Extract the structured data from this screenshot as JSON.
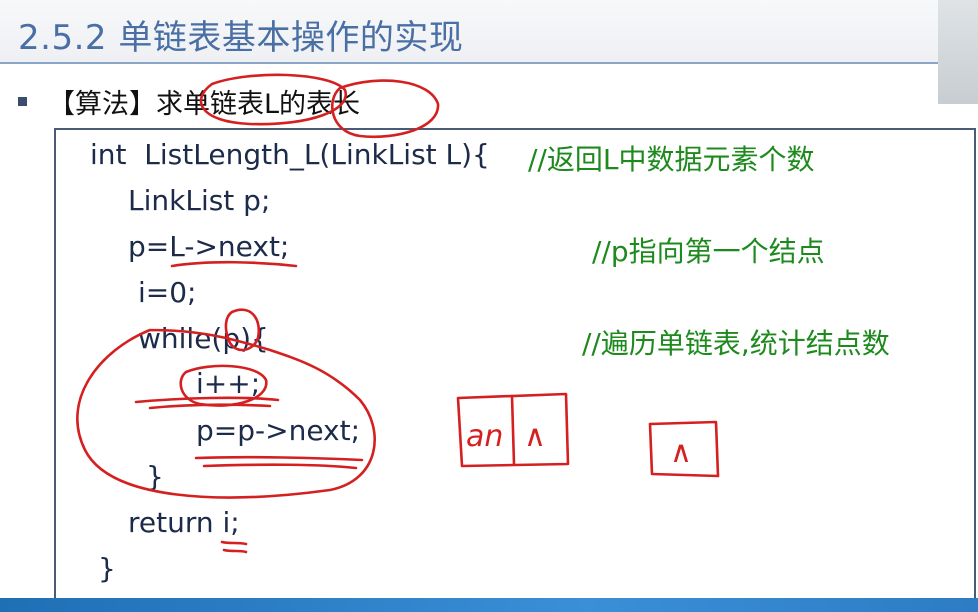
{
  "slide": {
    "title": "2.5.2 单链表基本操作的实现",
    "heading": "【算法】求单链表L的表长"
  },
  "code": {
    "line1": "int  ListLength_L(LinkList L){",
    "line2": "LinkList p;",
    "line3": "p=L->next;",
    "line4": "i=0;",
    "line5": "while(p){",
    "line6": "i++;",
    "line7": "p=p->next;",
    "line8": "}",
    "line9": "return i;",
    "line10": "}"
  },
  "comments": {
    "c1": "//返回L中数据元素个数",
    "c3": "//p指向第一个结点",
    "c5": "//遍历单链表,统计结点数"
  },
  "annotations": {
    "node_data": "an",
    "null_symbol": "∧"
  },
  "colors": {
    "title": "#4a6fa5",
    "code": "#1d2b4a",
    "comment": "#1e8a1e",
    "ink": "#d42020",
    "footer": "#2d7cc4"
  }
}
